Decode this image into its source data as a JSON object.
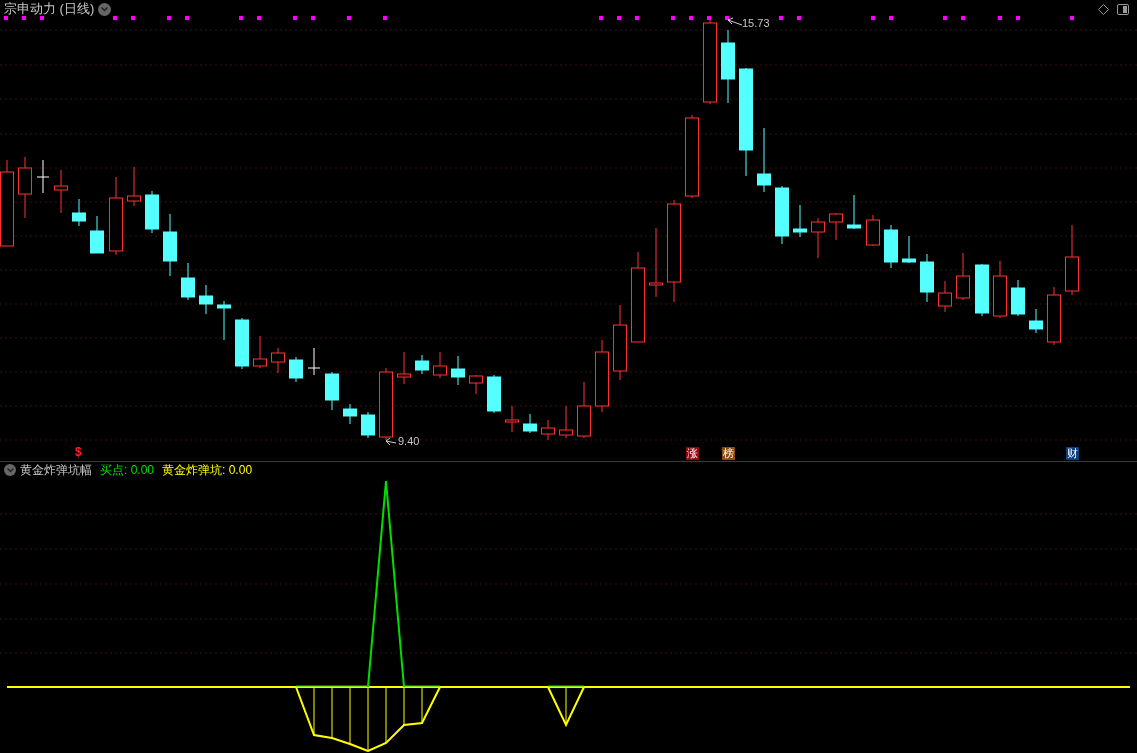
{
  "header": {
    "title": "宗申动力 (日线)"
  },
  "price_labels": [
    {
      "text": "15.73",
      "kind": "high"
    },
    {
      "text": "9.40",
      "kind": "low"
    }
  ],
  "signal_markers": [
    {
      "text": "$",
      "kind": "plain",
      "color": "#ff2020"
    },
    {
      "text": "涨",
      "kind": "badge",
      "color": "#8b0a0a"
    },
    {
      "text": "榜",
      "kind": "badge",
      "color": "#8b4a08"
    },
    {
      "text": "财",
      "kind": "badge",
      "color": "#0d3f7a"
    }
  ],
  "indicator": {
    "name": "黄金炸弹坑幅",
    "readings": [
      {
        "text": "买点: 0.00",
        "color": "#00e000"
      },
      {
        "text": "黄金炸弹坑: 0.00",
        "color": "#ffff00"
      }
    ]
  }
}
